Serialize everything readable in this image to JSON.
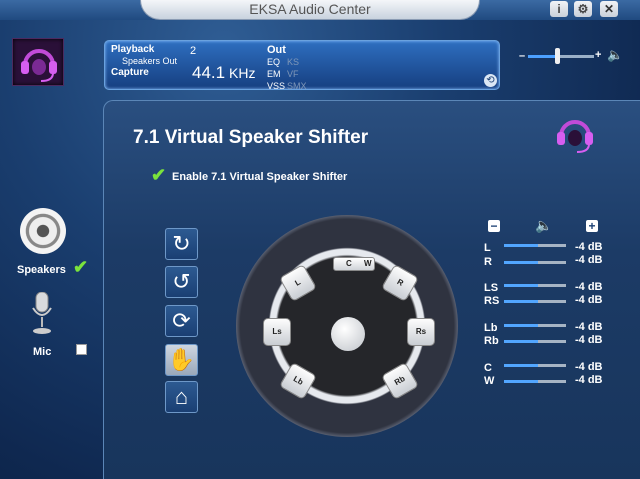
{
  "app": {
    "title": "EKSA Audio Center"
  },
  "titlebar": {
    "info_btn": "i",
    "settings_btn": "⚙",
    "close_btn": "✕"
  },
  "info_panel": {
    "playback_label": "Playback",
    "device": "Speakers Out",
    "channels": "2",
    "capture_label": "Capture",
    "sample_rate": "44.1",
    "sample_unit": "KHz",
    "out_label": "Out",
    "eq": "EQ",
    "ks": "KS",
    "em": "EM",
    "vf": "VF",
    "vss": "VSS",
    "smx": "SMX"
  },
  "master_volume": {
    "minus": "–",
    "plus": "+",
    "level": 0.42
  },
  "panel": {
    "title": "7.1 Virtual Speaker Shifter",
    "enable_label": "Enable 7.1 Virtual Speaker Shifter",
    "enable_checked": true
  },
  "devices": {
    "speakers_label": "Speakers",
    "speakers_checked": true,
    "mic_label": "Mic",
    "mic_checked": false
  },
  "tools": [
    "rotate-cw-icon",
    "rotate-ccw-icon",
    "rotate-reset-icon",
    "hand-icon",
    "home-icon"
  ],
  "speakers": {
    "c": "C",
    "w": "W",
    "l": "L",
    "r": "R",
    "ls": "Ls",
    "rs": "Rs",
    "lb": "Lb",
    "rb": "Rb"
  },
  "levels": {
    "minus": "−",
    "plus": "+",
    "channels": [
      {
        "label": "L",
        "value": "-4 dB"
      },
      {
        "label": "R",
        "value": "-4 dB"
      },
      {
        "label": "LS",
        "value": "-4 dB"
      },
      {
        "label": "RS",
        "value": "-4 dB"
      },
      {
        "label": "Lb",
        "value": "-4 dB"
      },
      {
        "label": "Rb",
        "value": "-4 dB"
      },
      {
        "label": "C",
        "value": "-4 dB"
      },
      {
        "label": "W",
        "value": "-4 dB"
      }
    ]
  }
}
